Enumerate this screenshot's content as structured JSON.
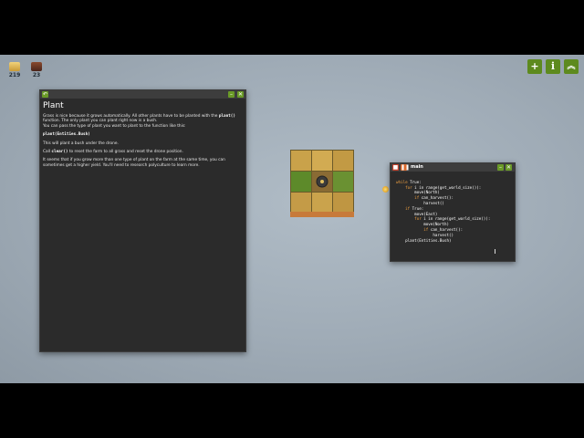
{
  "resources": [
    {
      "name": "hay",
      "icon": "hay-icon",
      "count": "219"
    },
    {
      "name": "wood",
      "icon": "wood-icon",
      "count": "23"
    }
  ],
  "toolbar": {
    "add_label": "+",
    "info_label": "i",
    "up_label": "︽"
  },
  "doc_window": {
    "back_label": "↶",
    "min_label": "–",
    "close_label": "✕",
    "title": "Plant",
    "p1_a": "Grass is nice because it grows automatically. All other plants have to be planted with the ",
    "p1_code": "plant()",
    "p1_b": " function. The only plant you can plant right now is a bush.",
    "p1_c": "You can pass the type of plant you want to plant to the function like this:",
    "code_example": "plant(Entities.Bush)",
    "p2": "This will plant a bush under the drone.",
    "p3_a": "Call ",
    "p3_code": "clear()",
    "p3_b": " to reset the farm to all grass and reset the drone position.",
    "p4": "It seems that if you grow more than one type of plant on the farm at the same time, you can sometimes get a higher yield. You'll need to research polyculture to learn more."
  },
  "editor": {
    "title": "main",
    "stop_label": "■",
    "pause_label": "❚❚",
    "min_label": "–",
    "close_label": "✕",
    "lines": [
      {
        "kw": "while",
        "rest": " True:"
      },
      {
        "kw": "    for",
        "rest": " i in range(get_world_size()):"
      },
      {
        "kw": "",
        "rest": "        move(North)"
      },
      {
        "kw": "        if",
        "rest": " can_harvest():"
      },
      {
        "kw": "",
        "rest": "            harvest()"
      },
      {
        "kw": "    if",
        "rest": " True:"
      },
      {
        "kw": "",
        "rest": "        move(East)"
      },
      {
        "kw": "        for",
        "rest": " i in range(get_world_size()):"
      },
      {
        "kw": "",
        "rest": "            move(North)"
      },
      {
        "kw": "            if",
        "rest": " can_harvest():"
      },
      {
        "kw": "",
        "rest": "                harvest()"
      },
      {
        "kw": "    ",
        "rest": "plant(Entities.Bush)"
      }
    ]
  }
}
